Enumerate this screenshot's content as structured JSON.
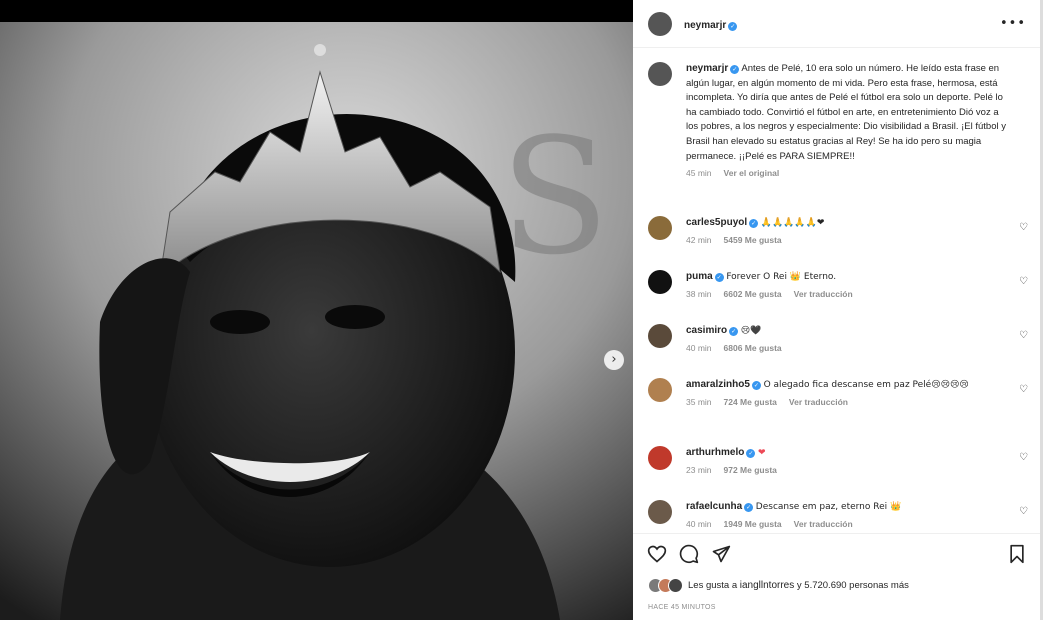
{
  "post": {
    "author": "neymarjr",
    "caption": "Antes de Pelé, 10 era solo un número. He leído esta frase en algún lugar, en algún momento de mi vida. Pero esta frase, hermosa, está incompleta. Yo diría que antes de Pelé el fútbol era solo un deporte. Pelé lo ha cambiado todo. Convirtió el fútbol en arte, en entretenimiento Dió voz a los pobres, a los negros y especialmente: Dio visibilidad a Brasil. ¡El fútbol y Brasil han elevado su estatus gracias al Rey! Se ha ido pero su magia permanece. ¡¡Pelé es PARA SIEMPRE!!",
    "caption_time": "45 min",
    "see_original": "Ver el original",
    "likes_prefix": "Les gusta a",
    "likes_user": "iangllntorres",
    "likes_middle": "y",
    "likes_count": "5.720.690 personas más",
    "time_ago": "HACE 45 MINUTOS"
  },
  "comments": [
    {
      "user": "carles5puyol",
      "text": "🙏🙏🙏🙏🙏❤",
      "time": "42 min",
      "likes": "5459 Me gusta",
      "translate": ""
    },
    {
      "user": "puma",
      "text": "Forever O Rei 👑 Eterno.",
      "time": "38 min",
      "likes": "6602 Me gusta",
      "translate": "Ver traducción"
    },
    {
      "user": "casimiro",
      "text": "😢🖤",
      "time": "40 min",
      "likes": "6806 Me gusta",
      "translate": ""
    },
    {
      "user": "amaralzinho5",
      "text": "O alegado fica descanse em paz Pelé😢😢😢😢",
      "time": "35 min",
      "likes": "724 Me gusta",
      "translate": "Ver traducción"
    },
    {
      "user": "arthurhmelo",
      "text": "❤",
      "time": "23 min",
      "likes": "972 Me gusta",
      "translate": ""
    },
    {
      "user": "rafaelcunha",
      "text": "Descanse em paz, eterno Rei 👑",
      "time": "40 min",
      "likes": "1949 Me gusta",
      "translate": "Ver traducción"
    }
  ],
  "icons": {
    "more": "more-options-icon",
    "like": "heart-icon",
    "comment": "comment-icon",
    "share": "share-icon",
    "save": "bookmark-icon",
    "next": "chevron-right-icon",
    "verified": "verified-badge-icon"
  },
  "colors": {
    "verified": "#3897f0",
    "heart_red": "#ed4956",
    "muted": "#8e8e8e",
    "text": "#262626"
  }
}
